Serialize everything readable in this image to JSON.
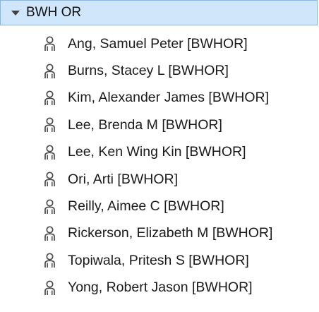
{
  "group": {
    "label": "BWH OR",
    "expanded": true,
    "highlight_color": "#cfe6fb",
    "border_color": "#7fb8ea",
    "toggle_icon": "caret-down-icon"
  },
  "items": [
    {
      "label": "Ang, Samuel Peter [BWHOR]",
      "icon": "person-icon"
    },
    {
      "label": "Burns, Stacey L [BWHOR]",
      "icon": "person-icon"
    },
    {
      "label": "Kim, Alexander James [BWHOR]",
      "icon": "person-icon"
    },
    {
      "label": "Lee, Brenda M [BWHOR]",
      "icon": "person-icon"
    },
    {
      "label": "Lee, Ken Wing Kin [BWHOR]",
      "icon": "person-icon"
    },
    {
      "label": "Ori, Arti [BWHOR]",
      "icon": "person-icon"
    },
    {
      "label": "Reilly, Aimee C [BWHOR]",
      "icon": "person-icon"
    },
    {
      "label": "Rickerson, Elizabeth M [BWHOR]",
      "icon": "person-icon"
    },
    {
      "label": "Topiwala, Pritesh S [BWHOR]",
      "icon": "person-icon"
    },
    {
      "label": "Yong, Robert Jason [BWHOR]",
      "icon": "person-icon"
    }
  ]
}
